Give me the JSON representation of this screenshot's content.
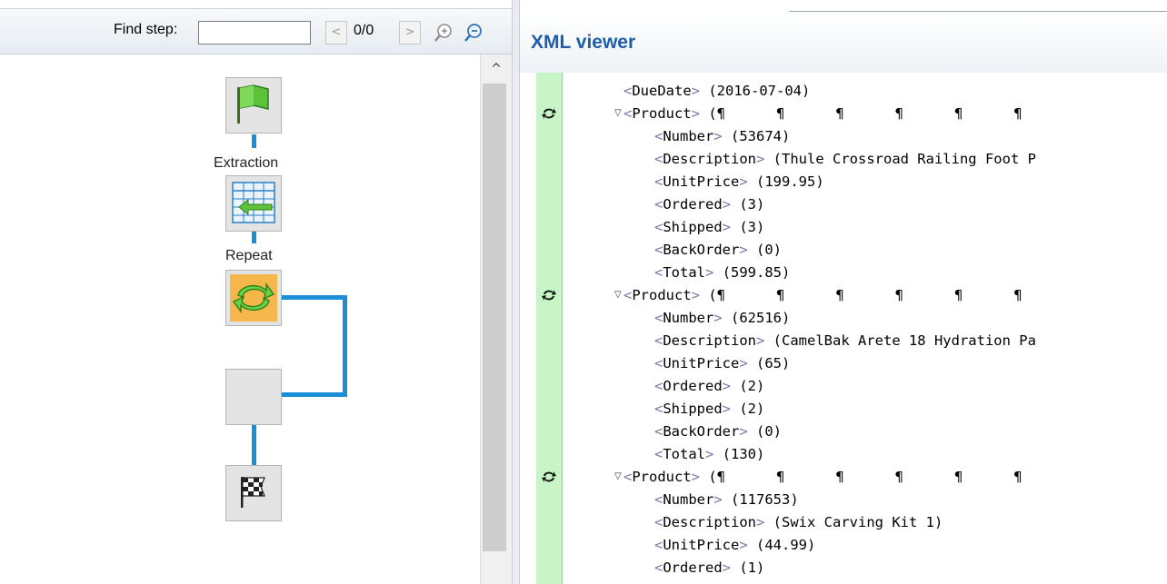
{
  "toolbar": {
    "find_label": "Find step:",
    "find_value": "",
    "prev_label": "<",
    "next_label": ">",
    "counter": "0/0"
  },
  "icons": {
    "zoom_in": "zoom-in-icon",
    "zoom_out": "zoom-out-icon",
    "scroll_up": "chevron-up-icon",
    "start": "green-flag-icon",
    "extraction": "table-extract-icon",
    "repeat": "repeat-arrows-icon",
    "end": "checkered-flag-icon",
    "row_toggle": "refresh-icon"
  },
  "flow": {
    "steps": [
      {
        "id": "start",
        "label": ""
      },
      {
        "id": "extraction",
        "label": "Extraction"
      },
      {
        "id": "repeat",
        "label": "Repeat"
      },
      {
        "id": "empty",
        "label": ""
      },
      {
        "id": "end",
        "label": ""
      }
    ]
  },
  "xml_viewer": {
    "title": "XML viewer",
    "lines": [
      {
        "indent": 1,
        "tag": "DueDate",
        "value": "(2016-07-04)"
      },
      {
        "indent": 1,
        "tag": "Product",
        "value": "(¶      ¶      ¶      ¶      ¶      ¶",
        "expandable": true
      },
      {
        "indent": 2,
        "tag": "Number",
        "value": "(53674)"
      },
      {
        "indent": 2,
        "tag": "Description",
        "value": "(Thule Crossroad Railing Foot P"
      },
      {
        "indent": 2,
        "tag": "UnitPrice",
        "value": "(199.95)"
      },
      {
        "indent": 2,
        "tag": "Ordered",
        "value": "(3)"
      },
      {
        "indent": 2,
        "tag": "Shipped",
        "value": "(3)"
      },
      {
        "indent": 2,
        "tag": "BackOrder",
        "value": "(0)"
      },
      {
        "indent": 2,
        "tag": "Total",
        "value": "(599.85)"
      },
      {
        "indent": 1,
        "tag": "Product",
        "value": "(¶      ¶      ¶      ¶      ¶      ¶",
        "expandable": true
      },
      {
        "indent": 2,
        "tag": "Number",
        "value": "(62516)"
      },
      {
        "indent": 2,
        "tag": "Description",
        "value": "(CamelBak Arete 18 Hydration Pa"
      },
      {
        "indent": 2,
        "tag": "UnitPrice",
        "value": "(65)"
      },
      {
        "indent": 2,
        "tag": "Ordered",
        "value": "(2)"
      },
      {
        "indent": 2,
        "tag": "Shipped",
        "value": "(2)"
      },
      {
        "indent": 2,
        "tag": "BackOrder",
        "value": "(0)"
      },
      {
        "indent": 2,
        "tag": "Total",
        "value": "(130)"
      },
      {
        "indent": 1,
        "tag": "Product",
        "value": "(¶      ¶      ¶      ¶      ¶      ¶",
        "expandable": true
      },
      {
        "indent": 2,
        "tag": "Number",
        "value": "(117653)"
      },
      {
        "indent": 2,
        "tag": "Description",
        "value": "(Swix Carving Kit 1)"
      },
      {
        "indent": 2,
        "tag": "UnitPrice",
        "value": "(44.99)"
      },
      {
        "indent": 2,
        "tag": "Ordered",
        "value": "(1)"
      }
    ]
  },
  "colors": {
    "connector": "#1a8fd8",
    "title": "#1e5ea9",
    "gutter": "#c8f5c8",
    "repeat_active": "#f5b64a"
  }
}
